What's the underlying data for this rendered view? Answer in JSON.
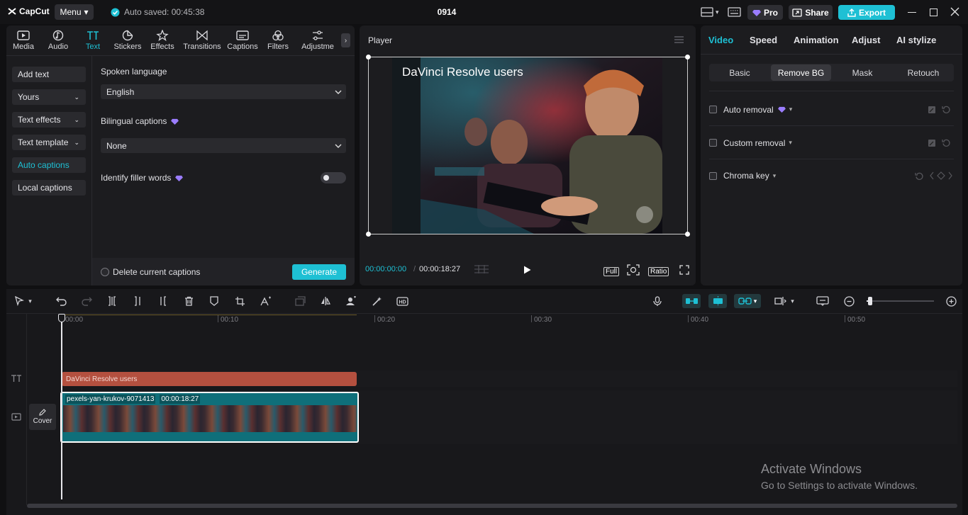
{
  "app": {
    "logo": "CapCut",
    "menu_label": "Menu",
    "autosave": "Auto saved: 00:45:38",
    "project_title": "0914",
    "pro_label": "Pro",
    "share_label": "Share",
    "export_label": "Export"
  },
  "tabs": [
    {
      "label": "Media",
      "icon": "media-icon"
    },
    {
      "label": "Audio",
      "icon": "audio-icon"
    },
    {
      "label": "Text",
      "icon": "text-icon"
    },
    {
      "label": "Stickers",
      "icon": "stickers-icon"
    },
    {
      "label": "Effects",
      "icon": "effects-icon"
    },
    {
      "label": "Transitions",
      "icon": "transitions-icon"
    },
    {
      "label": "Captions",
      "icon": "captions-icon"
    },
    {
      "label": "Filters",
      "icon": "filters-icon"
    },
    {
      "label": "Adjustme",
      "icon": "adjustment-icon"
    }
  ],
  "text_sidebar": [
    {
      "label": "Add text",
      "chevron": false
    },
    {
      "label": "Yours",
      "chevron": true
    },
    {
      "label": "Text effects",
      "chevron": true
    },
    {
      "label": "Text template",
      "chevron": true
    },
    {
      "label": "Auto captions",
      "chevron": false
    },
    {
      "label": "Local captions",
      "chevron": false
    }
  ],
  "captions": {
    "spoken_language_label": "Spoken language",
    "spoken_language_value": "English",
    "bilingual_label": "Bilingual captions",
    "bilingual_value": "None",
    "filler_label": "Identify filler words",
    "delete_label": "Delete current captions",
    "generate_label": "Generate"
  },
  "player": {
    "title": "Player",
    "overlay_text": "DaVinci Resolve users",
    "current_time": "00:00:00:00",
    "total_time": "00:00:18:27",
    "full_label": "Full",
    "ratio_label": "Ratio"
  },
  "inspector": {
    "tabs": [
      "Video",
      "Speed",
      "Animation",
      "Adjust",
      "AI stylize"
    ],
    "subtabs": [
      "Basic",
      "Remove BG",
      "Mask",
      "Retouch"
    ],
    "options": [
      "Auto removal",
      "Custom removal",
      "Chroma key"
    ]
  },
  "timeline": {
    "ticks": [
      "00:00",
      "00:10",
      "00:20",
      "00:30",
      "00:40",
      "00:50"
    ],
    "text_clip": "DaVinci Resolve users",
    "video_clip_name": "pexels-yan-krukov-9071413",
    "video_clip_duration": "00:00:18:27",
    "cover_label": "Cover"
  },
  "watermark": {
    "title": "Activate Windows",
    "subtitle": "Go to Settings to activate Windows."
  },
  "colors": {
    "accent": "#1ec0d4",
    "text_clip": "#b4503f",
    "video_clip": "#0f6f7a",
    "pro": "#9b7dff"
  }
}
